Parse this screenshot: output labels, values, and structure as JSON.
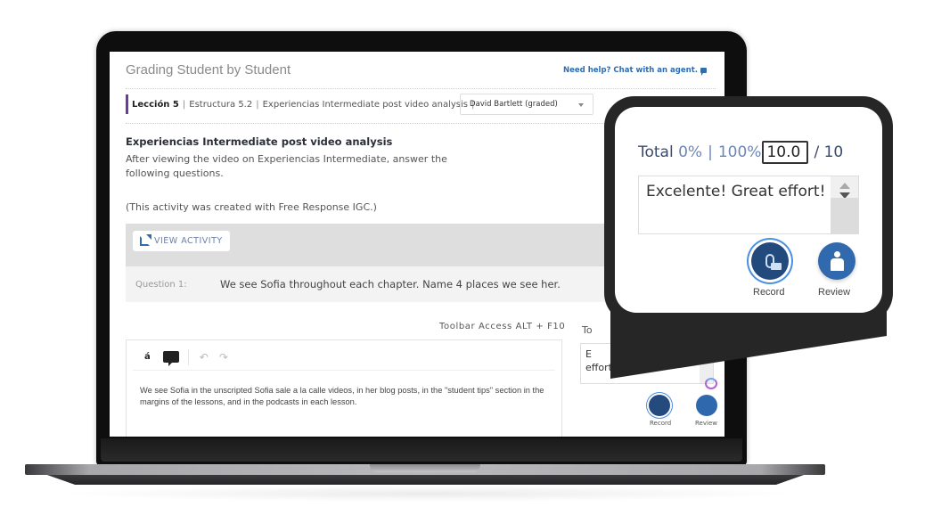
{
  "page": {
    "title": "Grading Student by Student",
    "help_link": "Need help? Chat with an agent."
  },
  "breadcrumb": {
    "lesson": "Lección 5",
    "section": "Estructura 5.2",
    "activity": "Experiencias Intermediate post video analysis",
    "separator": "|"
  },
  "student_select": {
    "selected": "David Bartlett (graded)"
  },
  "activity": {
    "title": "Experiencias Intermediate post video analysis",
    "description": "After viewing the video on Experiencias Intermediate, answer the following questions.",
    "note": "(This activity was created with Free Response IGC.)",
    "view_button": "VIEW ACTIVITY"
  },
  "question": {
    "label": "Question 1:",
    "text": "We see Sofia throughout each chapter. Name 4 places we see her."
  },
  "editor": {
    "toolbar_hint": "Toolbar Access ALT + F10",
    "accent_button": "á",
    "undo": "↶",
    "redo": "↷",
    "answer": "We see Sofia in the unscripted Sofia sale a la calle videos, in her blog posts, in the \"student tips\" section in the margins of the lessons, and in the podcasts in each lesson."
  },
  "side_panel": {
    "label_partial": "To",
    "comment_partial_1": "E",
    "comment_partial_2": "effort!",
    "arrow": "→",
    "record_label": "Record",
    "review_label": "Review"
  },
  "grading_callout": {
    "total_label": "Total",
    "pct_zero": "0%",
    "bar": "|",
    "pct_full": "100%",
    "score_value": "10.0",
    "out_of": "/ 10",
    "comment": "Excelente! Great effort!",
    "comment_arrow": "→",
    "record_label": "Record",
    "review_label": "Review"
  },
  "colors": {
    "accent_purple": "#6a3d9a",
    "link_blue": "#2f6cb0",
    "button_navy": "#234a7c",
    "button_blue": "#3069ad"
  }
}
